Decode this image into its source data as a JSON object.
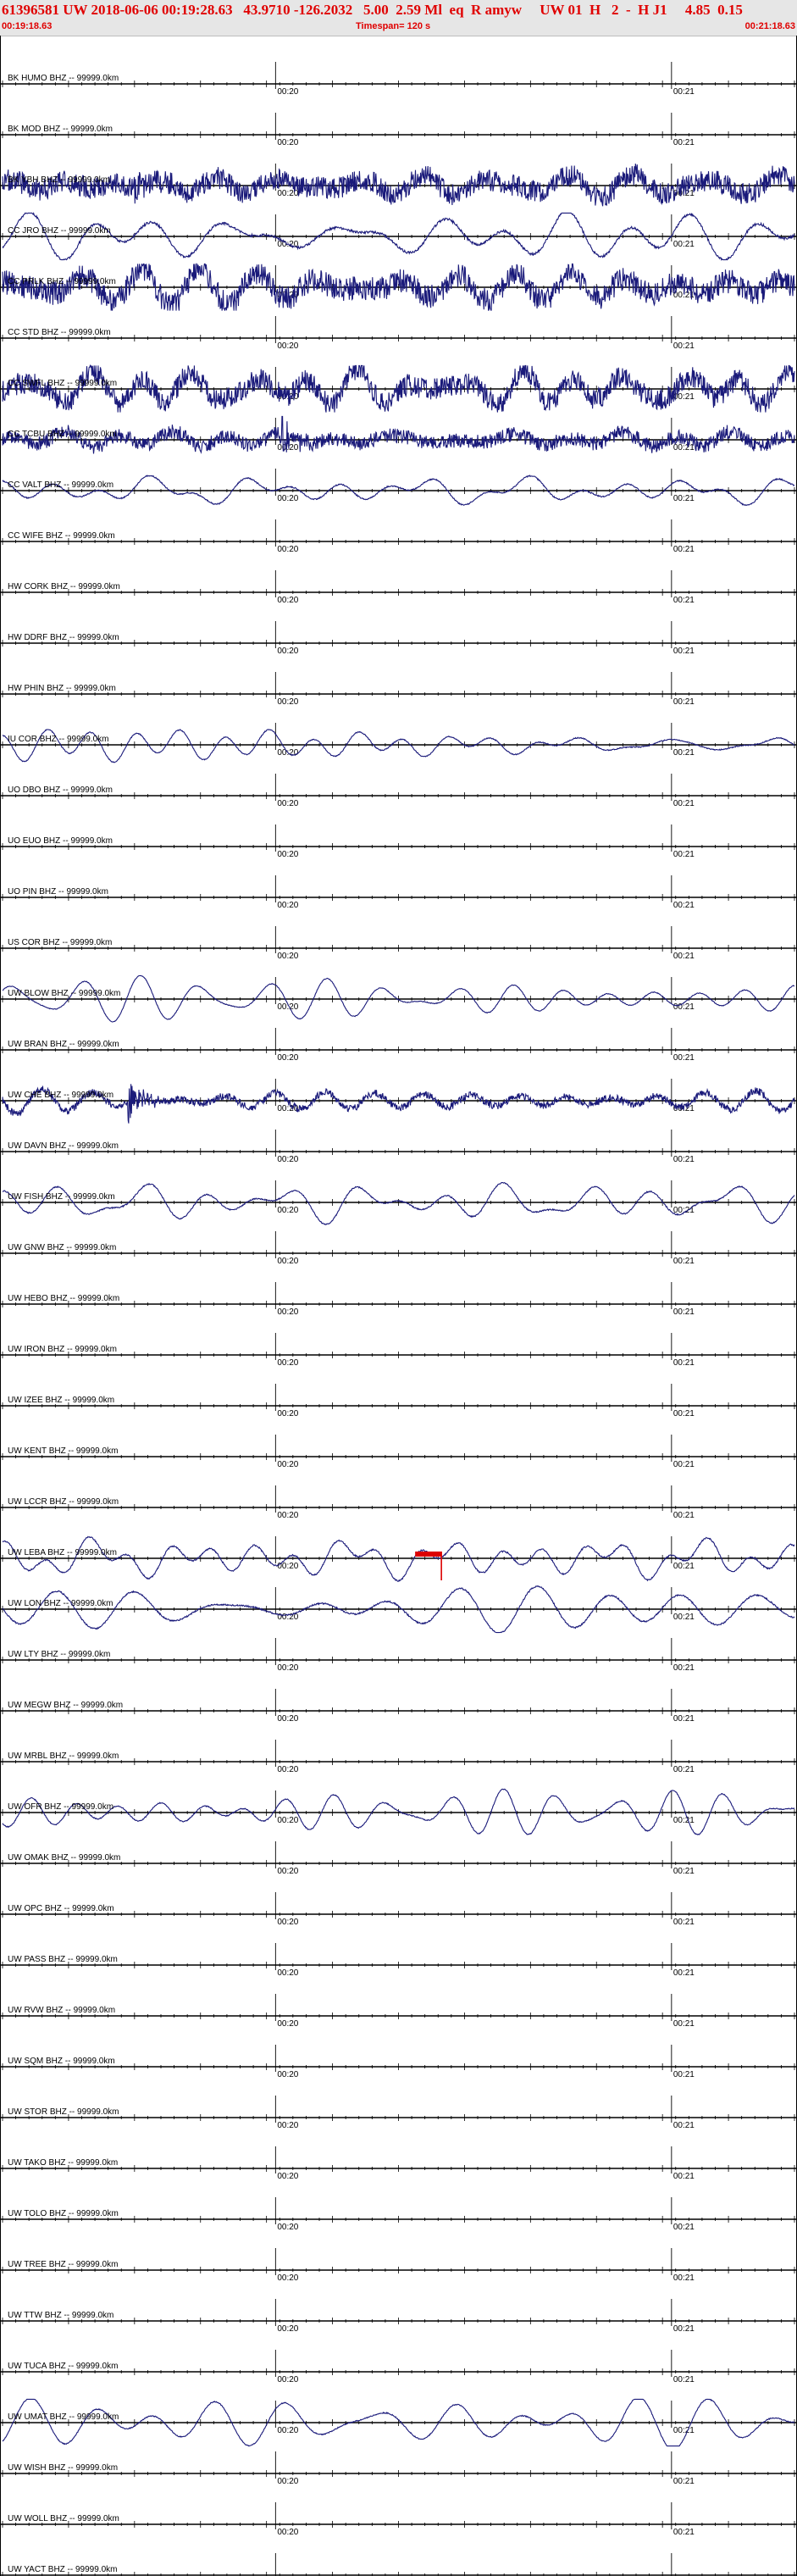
{
  "header": {
    "title": "61396581 UW 2018-06-06 00:19:28.63   43.9710 -126.2032   5.00  2.59 Ml  eq  R amyw     UW 01  H   2  -  H J1     4.85  0.15",
    "start_time": "00:19:18.63",
    "timespan": "Timespan= 120 s",
    "end_time": "00:21:18.63"
  },
  "colors": {
    "trace": "#1a1a7a",
    "axis": "#000000",
    "pick": "#dd0000",
    "header_text": "#e00000",
    "header_bg": "#e6e6e6"
  },
  "chart_data": {
    "type": "line",
    "x_range_s": [
      0,
      120
    ],
    "minute_ticks": [
      {
        "label": "00:20",
        "t": 41.37
      },
      {
        "label": "00:21",
        "t": 101.37
      }
    ],
    "pick": {
      "trace": "UW LEBA BHZ",
      "t": 66.5
    },
    "stations": [
      {
        "label": "BK HUMO BHZ -- 99999.0km",
        "amp": 0
      },
      {
        "label": "BK MOD BHZ -- 99999.0km",
        "amp": 0
      },
      {
        "label": "BK YBH BHZ -- 99999.0km",
        "amp": 0.55,
        "noise": 0.9,
        "burst": 20
      },
      {
        "label": "CC JRO BHZ -- 99999.0km",
        "amp": 0.9,
        "noise": 0.1
      },
      {
        "label": "CC PRLK BHZ -- 99999.0km",
        "amp": 0.7,
        "noise": 1.0
      },
      {
        "label": "CC STD BHZ -- 99999.0km",
        "amp": 0
      },
      {
        "label": "CC SWFL BHZ -- 99999.0km",
        "amp": 0.8,
        "noise": 0.9
      },
      {
        "label": "CC TCBU BHZ -- 99999.0km",
        "amp": 0.35,
        "noise": 0.6,
        "burst": 42
      },
      {
        "label": "CC VALT BHZ -- 99999.0km",
        "amp": 0.7,
        "noise": 0.05
      },
      {
        "label": "CC WIFE BHZ -- 99999.0km",
        "amp": 0
      },
      {
        "label": "HW CORK BHZ -- 99999.0km",
        "amp": 0
      },
      {
        "label": "HW DDRF BHZ -- 99999.0km",
        "amp": 0
      },
      {
        "label": "HW PHIN BHZ -- 99999.0km",
        "amp": 0
      },
      {
        "label": "IU COR BHZ -- 99999.0km",
        "amp": 0.55,
        "noise": 0.04
      },
      {
        "label": "UO DBO BHZ -- 99999.0km",
        "amp": 0
      },
      {
        "label": "UO EUO BHZ -- 99999.0km",
        "amp": 0
      },
      {
        "label": "UO PIN BHZ -- 99999.0km",
        "amp": 0
      },
      {
        "label": "US COR BHZ -- 99999.0km",
        "amp": 0
      },
      {
        "label": "UW BLOW BHZ -- 99999.0km",
        "amp": 0.9,
        "noise": 0.03
      },
      {
        "label": "UW BRAN BHZ -- 99999.0km",
        "amp": 0
      },
      {
        "label": "UW CHE BHZ -- 99999.0km",
        "amp": 0.5,
        "noise": 0.3,
        "burst": 19
      },
      {
        "label": "UW DAVN BHZ -- 99999.0km",
        "amp": 0
      },
      {
        "label": "UW FISH BHZ -- 99999.0km",
        "amp": 1.0,
        "noise": 0.05
      },
      {
        "label": "UW GNW BHZ -- 99999.0km",
        "amp": 0
      },
      {
        "label": "UW HEBO BHZ -- 99999.0km",
        "amp": 0
      },
      {
        "label": "UW IRON BHZ -- 99999.0km",
        "amp": 0
      },
      {
        "label": "UW IZEE BHZ -- 99999.0km",
        "amp": 0
      },
      {
        "label": "UW KENT BHZ -- 99999.0km",
        "amp": 0
      },
      {
        "label": "UW LCCR BHZ -- 99999.0km",
        "amp": 0
      },
      {
        "label": "UW LEBA BHZ -- 99999.0km",
        "amp": 0.8,
        "noise": 0.06
      },
      {
        "label": "UW LON BHZ -- 99999.0km",
        "amp": 0.9,
        "noise": 0.06
      },
      {
        "label": "UW LTY BHZ -- 99999.0km",
        "amp": 0
      },
      {
        "label": "UW MEGW BHZ -- 99999.0km",
        "amp": 0
      },
      {
        "label": "UW MRBL BHZ -- 99999.0km",
        "amp": 0
      },
      {
        "label": "UW OFR BHZ -- 99999.0km",
        "amp": 0.8,
        "noise": 0.04
      },
      {
        "label": "UW OMAK BHZ -- 99999.0km",
        "amp": 0
      },
      {
        "label": "UW OPC BHZ -- 99999.0km",
        "amp": 0
      },
      {
        "label": "UW PASS BHZ -- 99999.0km",
        "amp": 0
      },
      {
        "label": "UW RVW BHZ -- 99999.0km",
        "amp": 0
      },
      {
        "label": "UW SQM BHZ -- 99999.0km",
        "amp": 0
      },
      {
        "label": "UW STOR BHZ -- 99999.0km",
        "amp": 0
      },
      {
        "label": "UW TAKO BHZ -- 99999.0km",
        "amp": 0
      },
      {
        "label": "UW TOLO BHZ -- 99999.0km",
        "amp": 0
      },
      {
        "label": "UW TREE BHZ -- 99999.0km",
        "amp": 0
      },
      {
        "label": "UW TTW BHZ -- 99999.0km",
        "amp": 0
      },
      {
        "label": "UW TUCA BHZ -- 99999.0km",
        "amp": 0
      },
      {
        "label": "UW UMAT BHZ -- 99999.0km",
        "amp": 0.9,
        "noise": 0.04
      },
      {
        "label": "UW WISH BHZ -- 99999.0km",
        "amp": 0
      },
      {
        "label": "UW WOLL BHZ -- 99999.0km",
        "amp": 0
      },
      {
        "label": "UW YACT BHZ -- 99999.0km",
        "amp": 0
      }
    ]
  }
}
